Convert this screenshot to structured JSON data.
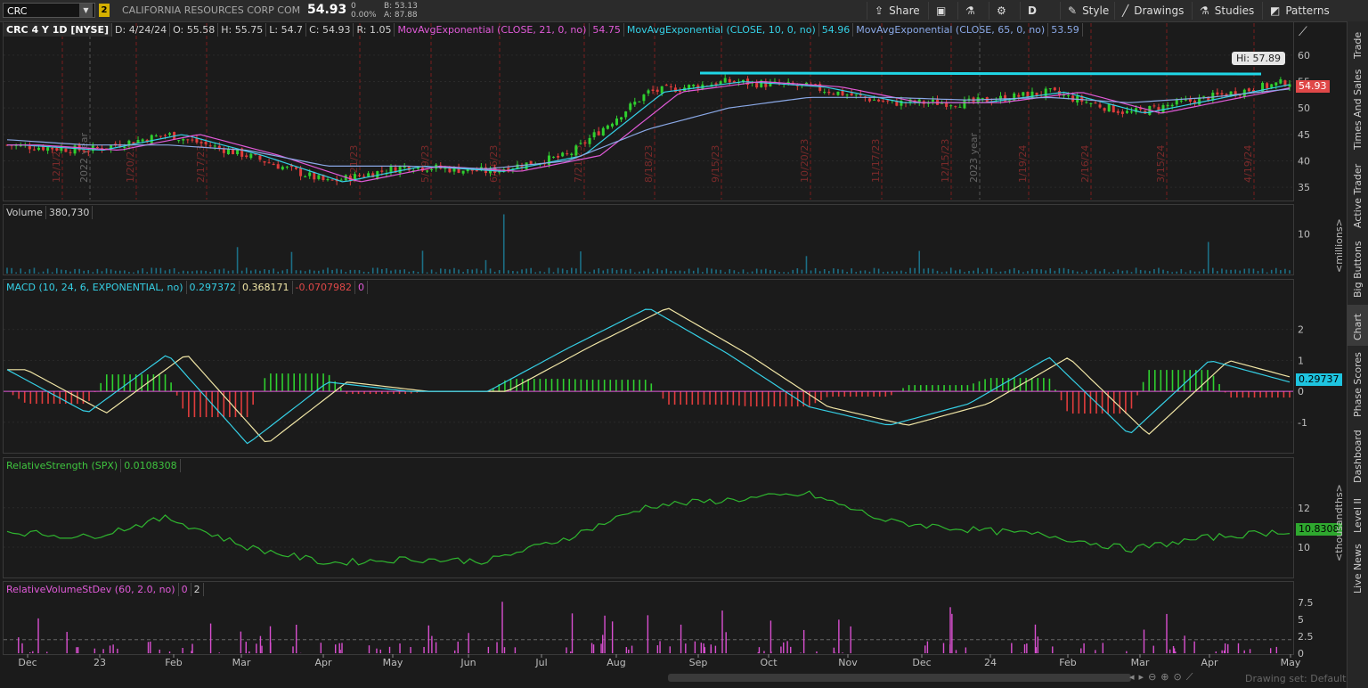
{
  "toolbar": {
    "symbol": "CRC",
    "link_badge": "2",
    "company": "CALIFORNIA RESOURCES CORP COM",
    "last": "54.93",
    "change": "0",
    "change_pct": "0.00%",
    "bid": "B: 53.13",
    "ask": "A: 87.88",
    "share": "Share",
    "aggregation": "D",
    "style": "Style",
    "drawings": "Drawings",
    "studies": "Studies",
    "patterns": "Patterns"
  },
  "price_panel": {
    "symbol_label": "CRC 4 Y 1D [NYSE]",
    "date": "D: 4/24/24",
    "open": "O: 55.58",
    "high": "H: 55.75",
    "low": "L: 54.7",
    "close": "C: 54.93",
    "range": "R: 1.05",
    "ema21_label": "MovAvgExponential (CLOSE, 21, 0, no)",
    "ema21_value": "54.75",
    "ema10_label": "MovAvgExponential (CLOSE, 10, 0, no)",
    "ema10_value": "54.96",
    "ema65_label": "MovAvgExponential (CLOSE, 65, 0, no)",
    "ema65_value": "53.59",
    "hi_bubble": "Hi: 57.89",
    "last_tag": "54.93",
    "y_ticks": [
      "60",
      "55",
      "50",
      "45",
      "40",
      "35"
    ],
    "period_markers": [
      "12/1/22",
      "2022 year",
      "1/20/23",
      "2/17/23",
      "4/21/23",
      "5/19/23",
      "6/16/23",
      "7/21/23",
      "8/18/23",
      "9/15/23",
      "10/20/23",
      "11/17/23",
      "12/15/23",
      "2023 year",
      "1/19/24",
      "2/16/24",
      "3/15/24",
      "4/19/24"
    ]
  },
  "volume_panel": {
    "label": "Volume",
    "value": "380,730",
    "y_ticks": [
      "10"
    ],
    "unit": "<millions>"
  },
  "macd_panel": {
    "label": "MACD (10, 24, 6, EXPONENTIAL, no)",
    "value": "0.297372",
    "avg": "0.368171",
    "diff": "-0.0707982",
    "zero": "0",
    "tag": "0.29737",
    "y_ticks": [
      "2",
      "1",
      "0",
      "-1"
    ]
  },
  "rs_panel": {
    "label": "RelativeStrength (SPX)",
    "value": "0.0108308",
    "tag": "10.8308",
    "y_ticks": [
      "12",
      "10"
    ],
    "unit": "<thousandths>"
  },
  "rvs_panel": {
    "label": "RelativeVolumeStDev (60, 2.0, no)",
    "v1": "0",
    "v2": "2",
    "y_ticks": [
      "7.5",
      "5",
      "2.5",
      "0"
    ]
  },
  "x_axis": [
    "Dec",
    "23",
    "Feb",
    "Mar",
    "Apr",
    "May",
    "Jun",
    "Jul",
    "Aug",
    "Sep",
    "Oct",
    "Nov",
    "Dec",
    "24",
    "Feb",
    "Mar",
    "Apr",
    "May"
  ],
  "sidebar": [
    "Trade",
    "Times And Sales",
    "Active Trader",
    "Big Buttons",
    "Chart",
    "Phase Scores",
    "Dashboard",
    "Level II",
    "Live News"
  ],
  "footer": "Drawing set: Default",
  "chart_data": [
    {
      "type": "line",
      "title": "CRC 4 Y 1D [NYSE]",
      "x": [
        "Dec",
        "Jan",
        "Feb",
        "Mar",
        "Apr",
        "May",
        "Jun",
        "Jul",
        "Aug",
        "Sep",
        "Oct",
        "Nov",
        "Dec",
        "Jan",
        "Feb",
        "Mar",
        "Apr"
      ],
      "series": [
        {
          "name": "Close",
          "values": [
            43,
            42,
            45,
            41,
            36,
            39,
            38,
            41,
            53,
            55,
            54,
            51,
            51,
            53,
            49,
            52,
            55
          ]
        },
        {
          "name": "MovAvgExponential (CLOSE, 65, 0, no)",
          "values": [
            44,
            43,
            43,
            42,
            39,
            39,
            38.5,
            40,
            46,
            50,
            52,
            52,
            51.5,
            52,
            51,
            52,
            53.6
          ]
        }
      ],
      "ylim": [
        33,
        62
      ],
      "hi": 57.89
    },
    {
      "type": "line",
      "title": "MACD (10, 24, 6, EXPONENTIAL, no)",
      "x": [
        "Dec",
        "Jan",
        "Feb",
        "Mar",
        "Apr",
        "May",
        "Jun",
        "Jul",
        "Aug",
        "Sep",
        "Oct",
        "Nov",
        "Dec",
        "Jan",
        "Feb",
        "Mar",
        "Apr"
      ],
      "series": [
        {
          "name": "MACD",
          "values": [
            0.7,
            -0.7,
            1.2,
            -1.7,
            0.3,
            0.0,
            0.0,
            1.4,
            2.7,
            1.2,
            -0.5,
            -1.1,
            -0.4,
            1.1,
            -1.4,
            1.0,
            0.3
          ]
        }
      ],
      "ylim": [
        -1.9,
        3.0
      ]
    },
    {
      "type": "line",
      "title": "RelativeStrength (SPX)",
      "x": [
        "Dec",
        "Jan",
        "Feb",
        "Mar",
        "Apr",
        "May",
        "Jun",
        "Jul",
        "Aug",
        "Sep",
        "Oct",
        "Nov",
        "Dec",
        "Jan",
        "Feb",
        "Mar",
        "Apr"
      ],
      "series": [
        {
          "name": "RelativeStrength (SPX)",
          "values": [
            10.8,
            10.5,
            11.5,
            10.0,
            9.2,
            9.4,
            9.3,
            10.5,
            12.1,
            12.4,
            12.7,
            11.3,
            10.9,
            10.6,
            9.9,
            10.5,
            10.83
          ]
        }
      ],
      "ylim": [
        8.6,
        13.8
      ]
    }
  ]
}
